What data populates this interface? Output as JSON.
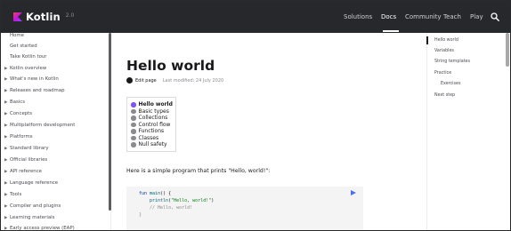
{
  "header": {
    "logo_text": "Kotlin",
    "version": "2.0",
    "nav": [
      {
        "label": "Solutions"
      },
      {
        "label": "Docs"
      },
      {
        "label": "Community"
      },
      {
        "label": "Teach"
      },
      {
        "label": "Play"
      }
    ],
    "active_nav": "Docs"
  },
  "sidebar": {
    "items": [
      {
        "label": "Home",
        "expandable": false
      },
      {
        "label": "Get started",
        "expandable": false
      },
      {
        "label": "Take Kotlin tour",
        "expandable": false
      },
      {
        "label": "Kotlin overview",
        "expandable": true
      },
      {
        "label": "What's new in Kotlin",
        "expandable": true
      },
      {
        "label": "Releases and roadmap",
        "expandable": true
      },
      {
        "label": "Basics",
        "expandable": true
      },
      {
        "label": "Concepts",
        "expandable": true
      },
      {
        "label": "Multiplatform development",
        "expandable": true
      },
      {
        "label": "Platforms",
        "expandable": true
      },
      {
        "label": "Standard library",
        "expandable": true
      },
      {
        "label": "Official libraries",
        "expandable": true
      },
      {
        "label": "API reference",
        "expandable": true
      },
      {
        "label": "Language reference",
        "expandable": true
      },
      {
        "label": "Tools",
        "expandable": true
      },
      {
        "label": "Compiler and plugins",
        "expandable": true
      },
      {
        "label": "Learning materials",
        "expandable": true
      },
      {
        "label": "Early access preview (EAP)",
        "expandable": true
      }
    ]
  },
  "main": {
    "title": "Hello world",
    "edit_label": "Edit page",
    "last_modified": "Last modified: 24 July 2020",
    "toc": [
      {
        "label": "Hello world"
      },
      {
        "label": "Basic types"
      },
      {
        "label": "Collections"
      },
      {
        "label": "Control flow"
      },
      {
        "label": "Functions"
      },
      {
        "label": "Classes"
      },
      {
        "label": "Null safety"
      }
    ],
    "intro": "Here is a simple program that prints \"Hello, world!\":",
    "code": {
      "line1_kw": "fun",
      "line1_fn": "main",
      "line1_rest": "() {",
      "line2_fn": "println",
      "line2_open": "(",
      "line2_str": "\"Hello, world!\"",
      "line2_close": ")",
      "line3_comment": "// Hello, world!",
      "line4": "}"
    }
  },
  "right_toc": {
    "items": [
      {
        "label": "Hello world"
      },
      {
        "label": "Variables"
      },
      {
        "label": "String templates"
      },
      {
        "label": "Practice"
      },
      {
        "label": "Exercises"
      },
      {
        "label": "Next step"
      }
    ]
  },
  "colors": {
    "topbar": "#27282c",
    "accent": "#7f52ff",
    "run_button": "#4c6ef5"
  }
}
